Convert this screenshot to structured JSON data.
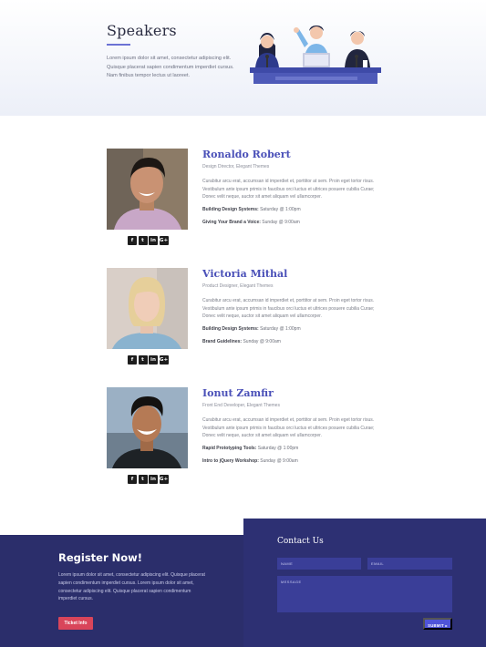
{
  "hero": {
    "title": "Speakers",
    "intro": "Lorem ipsum dolor sit amet, consectetur adipiscing elit. Quisque placerat sapien condimentum imperdiet cursus. Nam finibus tempor lectus ut laoreet."
  },
  "speakers": [
    {
      "name": "Ronaldo Robert",
      "role": "Design Director, Elegant Themes",
      "bio": "Curabitur arcu erat, accumsan id imperdiet et, porttitor at sem. Proin eget tortor risus. Vestibulum ante ipsum primis in faucibus orci luctus et ultrices posuere cubilia Curae; Donec velit neque, auctor sit amet aliquam vel ullamcorper.",
      "sessions": [
        {
          "title": "Building Design Systems:",
          "time": "Saturday @ 1:00pm"
        },
        {
          "title": "Giving Your Brand a Voice:",
          "time": "Sunday @ 9:00am"
        }
      ]
    },
    {
      "name": "Victoria Mithal",
      "role": "Product Designer, Elegant Themes",
      "bio": "Curabitur arcu erat, accumsan id imperdiet et, porttitor at sem. Proin eget tortor risus. Vestibulum ante ipsum primis in faucibus orci luctus et ultrices posuere cubilia Curae; Donec velit neque, auctor sit amet aliquam vel ullamcorper.",
      "sessions": [
        {
          "title": "Building Design Systems:",
          "time": "Saturday @ 1:00pm"
        },
        {
          "title": "Brand Guidelines:",
          "time": "Sunday @ 9:00am"
        }
      ]
    },
    {
      "name": "Ionut Zamfir",
      "role": "Front End Developer, Elegant Themes",
      "bio": "Curabitur arcu erat, accumsan id imperdiet et, porttitor at sem. Proin eget tortor risus. Vestibulum ante ipsum primis in faucibus orci luctus et ultrices posuere cubilia Curae; Donec velit neque, auctor sit amet aliquam vel ullamcorper.",
      "sessions": [
        {
          "title": "Rapid Prototyping Tools:",
          "time": "Saturday @ 1:00pm"
        },
        {
          "title": "Intro to jQuery Workshop:",
          "time": "Sunday @ 9:00am"
        }
      ]
    }
  ],
  "social_icons": [
    {
      "name": "facebook-icon",
      "glyph": "f"
    },
    {
      "name": "twitter-icon",
      "glyph": "t"
    },
    {
      "name": "linkedin-icon",
      "glyph": "in"
    },
    {
      "name": "google-plus-icon",
      "glyph": "G+"
    }
  ],
  "register": {
    "title": "Register Now!",
    "text": "Lorem ipsum dolor sit amet, consectetur adipiscing elit. Quisque placerat sapien condimentum imperdiet cursus. Lorem ipsum dolor sit amet, consectetur adipiscing elit. Quisque placerat sapien condimentum imperdiet cursus.",
    "button": "Ticket Info"
  },
  "contact": {
    "title": "Contact Us",
    "name_placeholder": "NAME",
    "email_placeholder": "EMAIL",
    "message_placeholder": "MESSAGE",
    "submit": "SUBMIT ▸"
  },
  "colors": {
    "accent": "#4a50b8",
    "register_bg": "#2b2e6b",
    "contact_bg": "#2d3073",
    "ticket_button": "#d9455a",
    "submit_button": "#4f54d8"
  }
}
